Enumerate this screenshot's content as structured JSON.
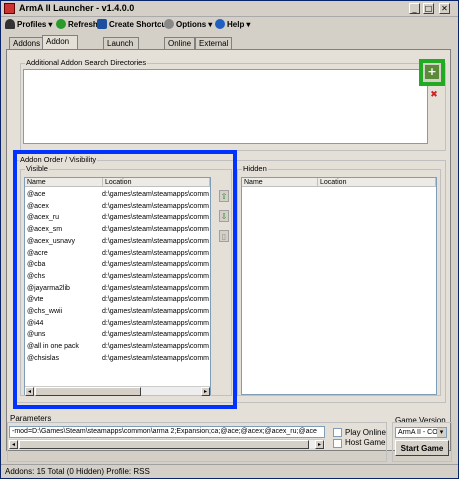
{
  "window": {
    "title": "ArmA II Launcher - v1.4.0.0",
    "minimize_label": "_",
    "maximize_label": "□",
    "close_label": "✕"
  },
  "menu": {
    "profiles": "Profiles",
    "refresh": "Refresh",
    "create_shortcut": "Create Shortcut",
    "options": "Options",
    "help": "Help",
    "dropdown_arrow": "▾"
  },
  "tabs": [
    "Addons",
    "Addon Options",
    "Launch Options",
    "Online",
    "External Apps"
  ],
  "search_dirs": {
    "label": "Additional Addon Search Directories",
    "add_glyph": "+",
    "remove_glyph": "✖"
  },
  "addon_order": {
    "label": "Addon Order / Visibility",
    "visible": {
      "label": "Visible",
      "columns": [
        "Name",
        "Location"
      ],
      "rows": [
        [
          "@ace",
          "d:\\games\\steam\\steamapps\\comm"
        ],
        [
          "@acex",
          "d:\\games\\steam\\steamapps\\comm"
        ],
        [
          "@acex_ru",
          "d:\\games\\steam\\steamapps\\comm"
        ],
        [
          "@acex_sm",
          "d:\\games\\steam\\steamapps\\comm"
        ],
        [
          "@acex_usnavy",
          "d:\\games\\steam\\steamapps\\comm"
        ],
        [
          "@acre",
          "d:\\games\\steam\\steamapps\\comm"
        ],
        [
          "@cba",
          "d:\\games\\steam\\steamapps\\comm"
        ],
        [
          "@chs",
          "d:\\games\\steam\\steamapps\\comm"
        ],
        [
          "@jayarma2lib",
          "d:\\games\\steam\\steamapps\\comm"
        ],
        [
          "@vte",
          "d:\\games\\steam\\steamapps\\comm"
        ],
        [
          "@chs_wwii",
          "d:\\games\\steam\\steamapps\\comm"
        ],
        [
          "@i44",
          "d:\\games\\steam\\steamapps\\comm"
        ],
        [
          "@uns",
          "d:\\games\\steam\\steamapps\\comm"
        ],
        [
          "@all in one pack",
          "d:\\games\\steam\\steamapps\\comm"
        ],
        [
          "@chsislas",
          "d:\\games\\steam\\steamapps\\comm"
        ]
      ],
      "move_up_glyph": "⇧",
      "move_down_glyph": "⇩",
      "delete_glyph": "▯"
    },
    "hidden": {
      "label": "Hidden",
      "columns": [
        "Name",
        "Location"
      ]
    }
  },
  "scroll": {
    "left": "◂",
    "right": "▸"
  },
  "parameters": {
    "label": "Parameters",
    "value": "-mod=D:\\Games\\Steam\\steamapps\\common\\arma 2;Expansion;ca;@ace;@acex;@acex_ru;@ace",
    "play_online": "Play Online",
    "host_game": "Host Game"
  },
  "game_version": {
    "label": "Game Version",
    "selected": "ArmA II - CO",
    "arrow": "▾"
  },
  "start_game": "Start Game",
  "status": {
    "text": "Addons: 15 Total (0 Hidden)  Profile:  RSS"
  },
  "colors": {
    "highlight_green": "#22aa22",
    "highlight_blue": "#0033ff"
  }
}
